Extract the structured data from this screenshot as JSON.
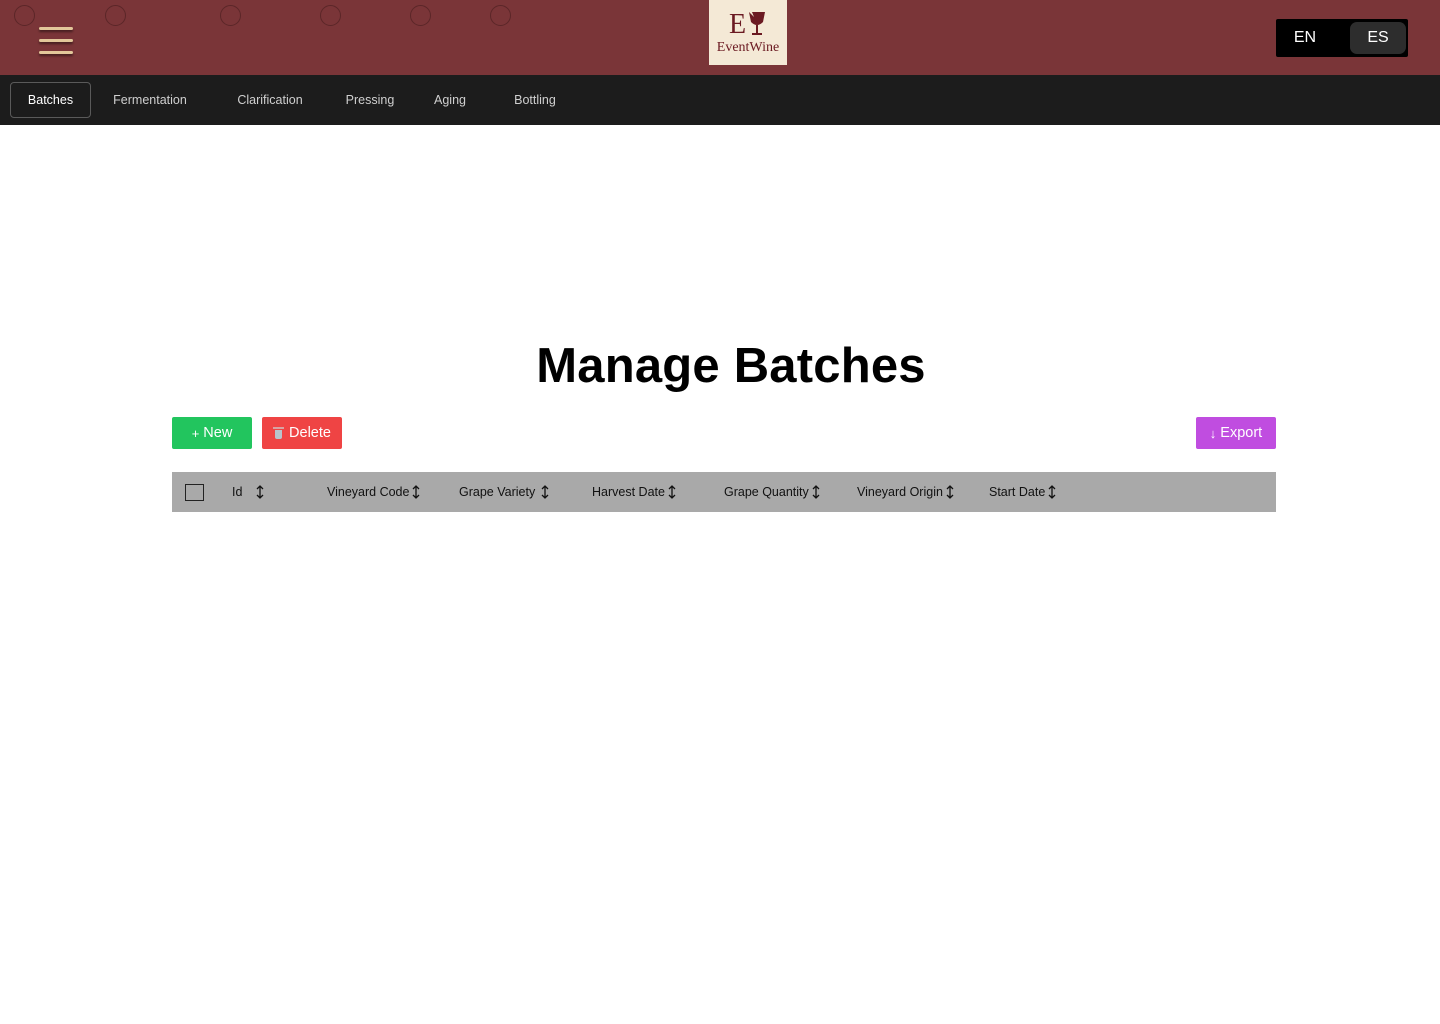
{
  "header": {
    "logo_text": "EventWine",
    "logo_mark": "E",
    "languages": [
      "EN",
      "ES"
    ],
    "active_language": "ES"
  },
  "nav": {
    "tabs": [
      {
        "label": "Batches",
        "active": true
      },
      {
        "label": "Fermentation",
        "active": false
      },
      {
        "label": "Clarification",
        "active": false
      },
      {
        "label": "Pressing",
        "active": false
      },
      {
        "label": "Aging",
        "active": false
      },
      {
        "label": "Bottling",
        "active": false
      }
    ]
  },
  "main": {
    "title": "Manage Batches",
    "buttons": {
      "new_label": "New",
      "new_icon": "+",
      "delete_label": "Delete",
      "delete_icon": "trash-icon",
      "export_label": "Export",
      "export_icon": "↓"
    },
    "table": {
      "columns": [
        "Id",
        "Vineyard Code",
        "Grape Variety",
        "Harvest Date",
        "Grape Quantity",
        "Vineyard Origin",
        "Start Date"
      ],
      "rows": []
    }
  },
  "colors": {
    "header_bg": "#7a3538",
    "nav_bg": "#1c1c1c",
    "new_button": "#22c55e",
    "delete_button": "#ef4444",
    "export_button": "#c04de0",
    "table_header_bg": "#a9a9a9"
  }
}
